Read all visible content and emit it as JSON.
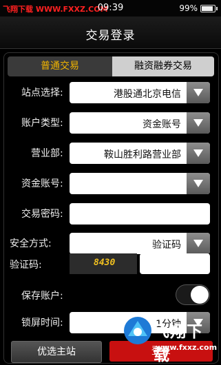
{
  "status_bar": {
    "watermark": "飞翔下载 WWW.FXXZ.COM",
    "time": "09:39",
    "battery": "99%",
    "battery_level": 0.99
  },
  "header": {
    "title": "交易登录"
  },
  "tabs": [
    {
      "label": "普通交易",
      "active": true
    },
    {
      "label": "融资融券交易",
      "active": false
    }
  ],
  "form": {
    "site": {
      "label": "站点选择:",
      "value": "港股通北京电信"
    },
    "account_type": {
      "label": "账户类型:",
      "value": "资金账号"
    },
    "branch": {
      "label": "营业部:",
      "value": "鞍山胜利路营业部"
    },
    "account_no": {
      "label": "资金账号:",
      "value": ""
    },
    "password": {
      "label": "交易密码:",
      "value": ""
    },
    "security": {
      "label": "安全方式:",
      "value": "验证码"
    },
    "captcha": {
      "label": "验证码:",
      "code": "8430",
      "value": ""
    },
    "save_account": {
      "label": "保存账户:",
      "on": false
    },
    "lock_time": {
      "label": "锁屏时间:",
      "value": "1分钟"
    }
  },
  "buttons": {
    "preferred_site": "优选主站",
    "login": "登录"
  },
  "watermark": {
    "main": "飞翔下载",
    "url": "www.fxxz.com"
  },
  "colors": {
    "accent": "#f0b400",
    "login": "#c81010"
  }
}
